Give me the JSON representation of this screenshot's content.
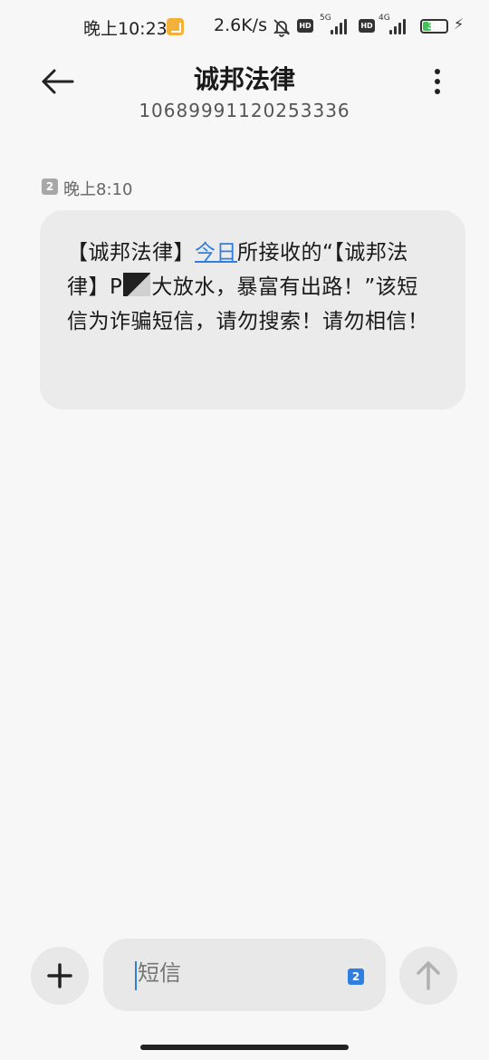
{
  "status_bar": {
    "time": "晚上10:23",
    "net_speed": "2.6K/s",
    "hd1": "HD",
    "sig1_label": "5G",
    "hd2": "HD",
    "sig2_label": "4G",
    "battery_level": "39",
    "battery_fraction": 0.39,
    "icons": [
      "note-icon",
      "mute-bell-icon",
      "signal-icon",
      "battery-icon",
      "charging-icon"
    ]
  },
  "header": {
    "title": "诚邦法律",
    "number": "10689991120253336"
  },
  "message": {
    "sim": "2",
    "time": "晚上8:10",
    "text_before_link": "【诚邦法律】",
    "link_text": "今日",
    "text_after_link": "所接收的“【诚邦法律】P",
    "text_after_redaction": "大放水，暴富有出路！”该短信为诈骗短信，请勿搜索！请勿相信！"
  },
  "composer": {
    "placeholder": "短信",
    "sim": "2"
  },
  "colors": {
    "accent": "#2f7fe0",
    "bubble": "#ebebeb",
    "background": "#f7f7f7",
    "battery": "#44c25a"
  }
}
